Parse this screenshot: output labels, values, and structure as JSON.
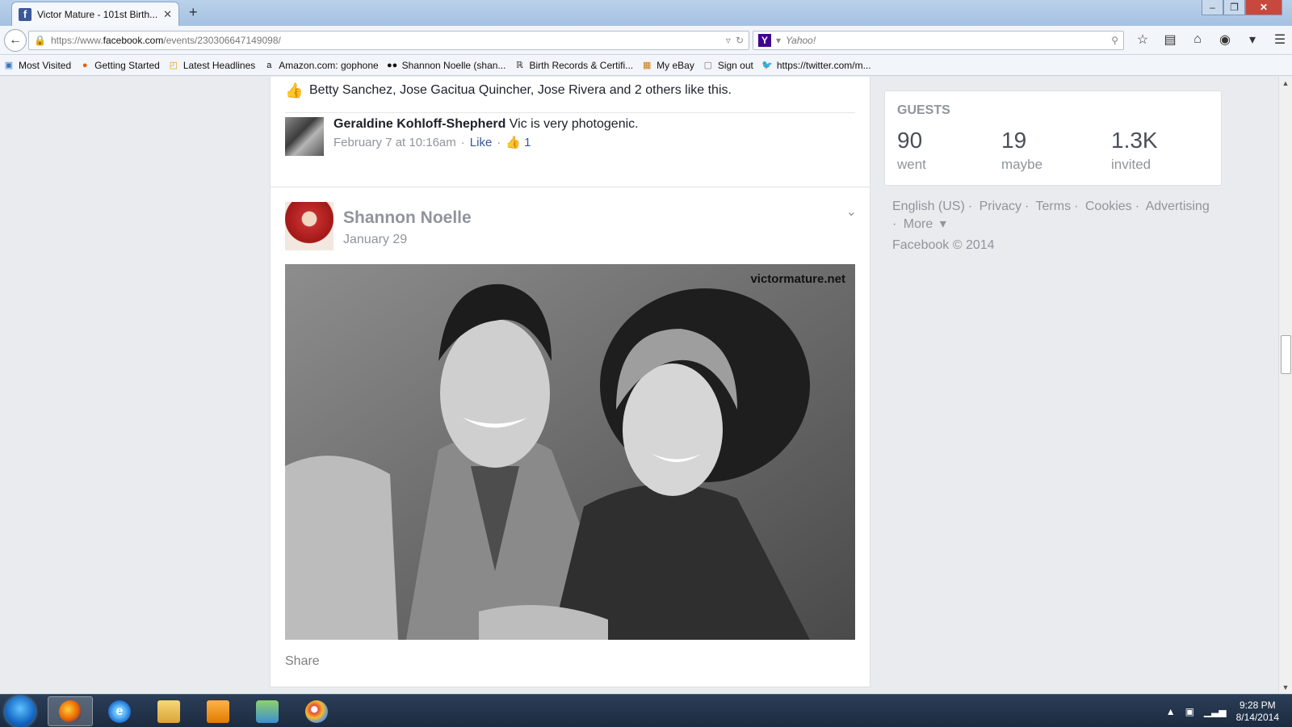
{
  "browser": {
    "tab_title": "Victor Mature - 101st Birth...",
    "tab_close": "✕",
    "new_tab": "+",
    "url_prefix": "https://www.",
    "url_domain": "facebook.com",
    "url_path": "/events/230306647149098/",
    "search_placeholder": "Yahoo!",
    "bookmarks": [
      {
        "label": "Most Visited",
        "icon": "most-visited-icon"
      },
      {
        "label": "Getting Started",
        "icon": "firefox-icon"
      },
      {
        "label": "Latest Headlines",
        "icon": "rss-icon"
      },
      {
        "label": "Amazon.com: gophone",
        "icon": "amazon-icon"
      },
      {
        "label": "Shannon Noelle (shan...",
        "icon": "people-icon"
      },
      {
        "label": "Birth Records & Certifi...",
        "icon": "rb-icon"
      },
      {
        "label": "My eBay",
        "icon": "ebay-icon"
      },
      {
        "label": "Sign out",
        "icon": "page-icon"
      },
      {
        "label": "https://twitter.com/m...",
        "icon": "twitter-icon"
      }
    ]
  },
  "comment_card": {
    "likes_text": "Betty Sanchez, Jose Gacitua Quincher, Jose Rivera and 2 others like this.",
    "comment": {
      "author": "Geraldine Kohloff-Shepherd",
      "text": "Vic is very photogenic.",
      "timestamp": "February 7 at 10:16am",
      "like_label": "Like",
      "like_count": "1"
    }
  },
  "post": {
    "author": "Shannon Noelle",
    "date": "January 29",
    "watermark": "victormature.net",
    "share_label": "Share"
  },
  "guests": {
    "title": "GUESTS",
    "stats": [
      {
        "value": "90",
        "label": "went"
      },
      {
        "value": "19",
        "label": "maybe"
      },
      {
        "value": "1.3K",
        "label": "invited"
      }
    ]
  },
  "footer": {
    "links": [
      "English (US)",
      "Privacy",
      "Terms",
      "Cookies",
      "Advertising",
      "More"
    ],
    "copyright": "Facebook © 2014"
  },
  "taskbar": {
    "time": "9:28 PM",
    "date": "8/14/2014"
  }
}
